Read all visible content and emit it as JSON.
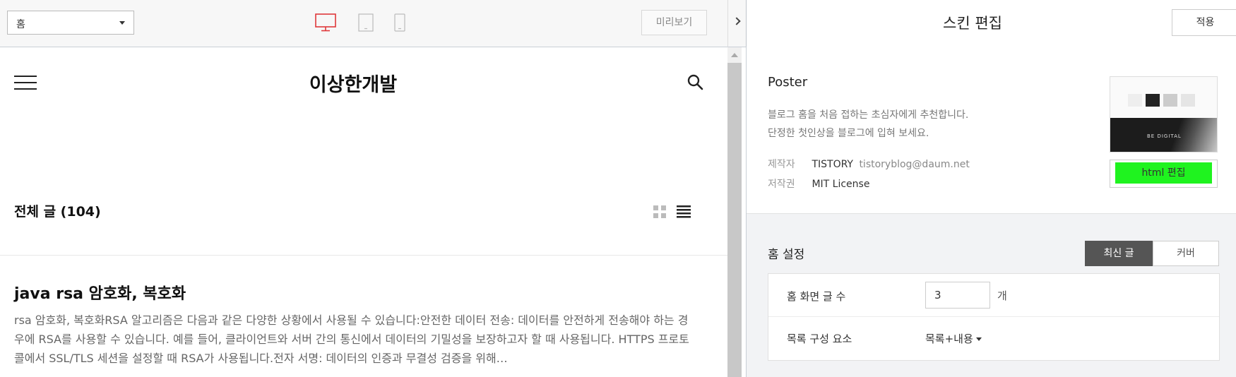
{
  "toolbar": {
    "page_select": "홈",
    "preview_label": "미리보기"
  },
  "blog": {
    "title": "이상한개발",
    "section_title": "전체 글 (104)",
    "post": {
      "title": "java rsa 암호화, 복호화",
      "excerpt": "rsa 암호화, 복호화RSA 알고리즘은 다음과 같은 다양한 상황에서 사용될 수 있습니다:안전한 데이터 전송: 데이터를 안전하게 전송해야 하는 경우에 RSA를 사용할 수 있습니다. 예를 들어, 클라이언트와 서버 간의 통신에서 데이터의 기밀성을 보장하고자 할 때 사용됩니다. HTTPS 프로토콜에서 SSL/TLS 세션을 설정할 때 RSA가 사용됩니다.전자 서명: 데이터의 인증과 무결성 검증을 위해…"
    }
  },
  "editor": {
    "title": "스킨 편집",
    "apply_label": "적용",
    "skin": {
      "name": "Poster",
      "desc_line1": "블로그 홈을 처음 접하는 초심자에게 추천합니다.",
      "desc_line2": "단정한 첫인상을 블로그에 입혀 보세요.",
      "maker_label": "제작자",
      "maker": "TISTORY",
      "maker_email": "tistoryblog@daum.net",
      "license_label": "저작권",
      "license": "MIT License",
      "thumb_text": "BE DIGITAL",
      "html_edit_label": "html 편집"
    },
    "home_settings": {
      "title": "홈 설정",
      "tab_latest": "최신 글",
      "tab_cover": "커버",
      "post_count_label": "홈 화면 글 수",
      "post_count_value": "3",
      "post_count_unit": "개",
      "list_label": "목록 구성 요소",
      "list_value": "목록+내용"
    }
  },
  "colors": {
    "desktop_icon_active": "#e0373a",
    "html_edit_button": "#1ff31f",
    "tab_active_bg": "#555555"
  }
}
